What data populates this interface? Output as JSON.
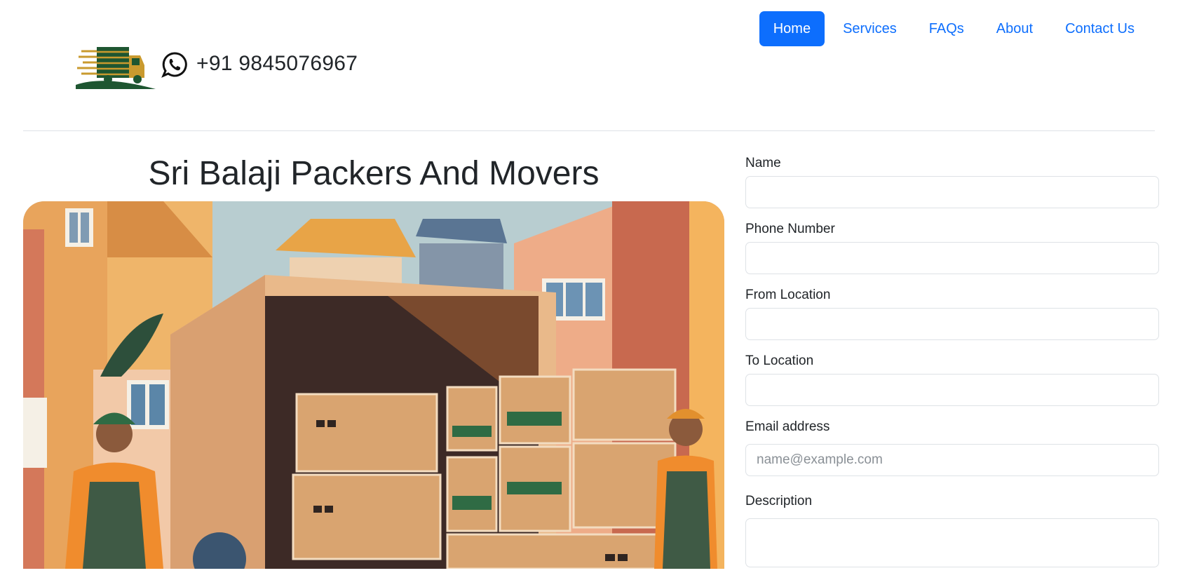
{
  "header": {
    "logo_icon": "moving-truck-logo",
    "whatsapp_icon": "whatsapp-icon",
    "phone": "+91 9845076967"
  },
  "nav": {
    "items": [
      {
        "label": "Home",
        "active": true
      },
      {
        "label": "Services",
        "active": false
      },
      {
        "label": "FAQs",
        "active": false
      },
      {
        "label": "About",
        "active": false
      },
      {
        "label": "Contact Us",
        "active": false
      }
    ],
    "accent": "#0d6efd"
  },
  "main": {
    "title": "Sri Balaji Packers And Movers",
    "hero_image": "movers-loading-boxes-illustration"
  },
  "form": {
    "name": {
      "label": "Name",
      "value": ""
    },
    "phone": {
      "label": "Phone Number",
      "value": ""
    },
    "from": {
      "label": "From Location",
      "value": ""
    },
    "to": {
      "label": "To Location",
      "value": ""
    },
    "email": {
      "label": "Email address",
      "value": "",
      "placeholder": "name@example.com"
    },
    "description": {
      "label": "Description",
      "value": ""
    }
  }
}
